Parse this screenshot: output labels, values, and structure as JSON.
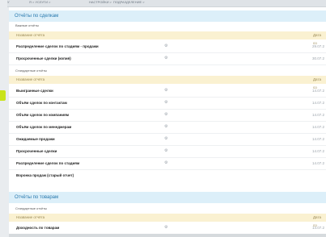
{
  "topbar": {
    "items": [
      "ЧКУ",
      "Я > УСЛУГИ >",
      "НАСТРОЙКИ >",
      "ПОДРАЗДЕЛЕНИЕ >"
    ]
  },
  "sections": [
    {
      "title": "Отчёты по сделкам",
      "groups": [
        {
          "label": "Важные отчёты",
          "header": {
            "name": "Название отчёта",
            "date": "Дата со"
          },
          "rows": [
            {
              "name": "Распределение сделок по стадиям - продажи",
              "date": "29.07.2"
            },
            {
              "name": "Просроченные сделки (копия)",
              "date": "30.07.2"
            }
          ]
        },
        {
          "label": "Стандартные отчёты",
          "header": {
            "name": "Название отчёта",
            "date": "Дата со"
          },
          "rows": [
            {
              "name": "Выигранные сделки",
              "date": "14.07.2"
            },
            {
              "name": "Объём сделок по контактам",
              "date": "14.07.2"
            },
            {
              "name": "Объём сделок по компаниям",
              "date": "14.07.2"
            },
            {
              "name": "Объём сделок по менеджерам",
              "date": "14.07.2"
            },
            {
              "name": "Ожидаемые продажи",
              "date": "14.07.2"
            },
            {
              "name": "Просроченные сделки",
              "date": "14.07.2"
            },
            {
              "name": "Распределение сделок по стадиям",
              "date": "14.07.2"
            },
            {
              "name": "Воронка продаж (старый отчет)",
              "date": ""
            }
          ]
        }
      ]
    },
    {
      "title": "Отчёты по товарам",
      "groups": [
        {
          "label": "Стандартные отчёты",
          "header": {
            "name": "Название отчёта",
            "date": "Дата со"
          },
          "rows": [
            {
              "name": "Доходность по товарам",
              "date": "14.07.2"
            }
          ]
        }
      ]
    }
  ]
}
